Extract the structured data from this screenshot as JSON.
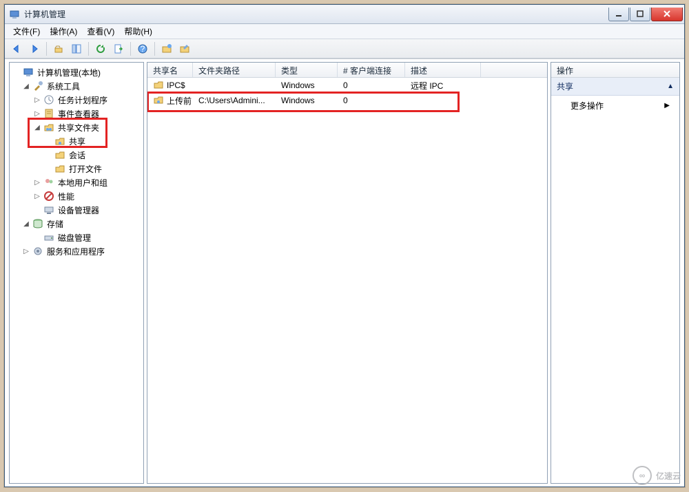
{
  "window": {
    "title": "计算机管理"
  },
  "menu": {
    "file": "文件(F)",
    "action": "操作(A)",
    "view": "查看(V)",
    "help": "帮助(H)"
  },
  "tree": {
    "root": "计算机管理(本地)",
    "system_tools": "系统工具",
    "task_scheduler": "任务计划程序",
    "event_viewer": "事件查看器",
    "shared_folders": "共享文件夹",
    "shares": "共享",
    "sessions": "会话",
    "open_files": "打开文件",
    "local_users": "本地用户和组",
    "performance": "性能",
    "device_manager": "设备管理器",
    "storage": "存储",
    "disk_management": "磁盘管理",
    "services_apps": "服务和应用程序"
  },
  "columns": {
    "c0": "共享名",
    "c1": "文件夹路径",
    "c2": "类型",
    "c3": "# 客户端连接",
    "c4": "描述"
  },
  "rows": [
    {
      "name": "IPC$",
      "path": "",
      "type": "Windows",
      "clients": "0",
      "desc": "远程 IPC"
    },
    {
      "name": "上传前",
      "path": "C:\\Users\\Admini...",
      "type": "Windows",
      "clients": "0",
      "desc": ""
    }
  ],
  "actions": {
    "header": "操作",
    "section": "共享",
    "more": "更多操作"
  },
  "watermark": "亿速云"
}
